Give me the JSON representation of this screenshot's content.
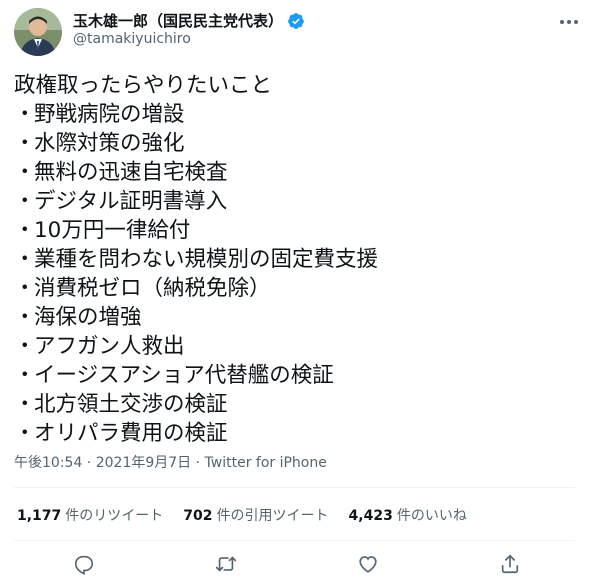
{
  "author": {
    "name": "玉木雄一郎（国民民主党代表）",
    "handle": "@tamakiyuichiro"
  },
  "icons": {
    "avatar": "avatar",
    "verified": "verified-badge-icon",
    "more": "more-options-icon",
    "reply": "reply-icon",
    "retweet": "retweet-icon",
    "like": "like-icon",
    "share": "share-icon"
  },
  "colors": {
    "text": "#0f1419",
    "secondary": "#536471",
    "verified": "#1d9bf0",
    "divider": "#eff3f4"
  },
  "tweet": {
    "heading": "政権取ったらやりたいこと",
    "bullet": "・",
    "items": [
      "野戦病院の増設",
      "水際対策の強化",
      "無料の迅速自宅検査",
      "デジタル証明書導入",
      "10万円一律給付",
      "業種を問わない規模別の固定費支援",
      "消費税ゼロ（納税免除）",
      "海保の増強",
      "アフガン人救出",
      "イージスアショア代替艦の検証",
      "北方領土交渉の検証",
      "オリパラ費用の検証"
    ]
  },
  "meta": {
    "time": "午後10:54",
    "sep1": " · ",
    "date": "2021年9月7日",
    "sep2": " · ",
    "source": "Twitter for iPhone"
  },
  "stats": {
    "retweets_count": "1,177",
    "retweets_label": "件のリツイート",
    "quotes_count": "702",
    "quotes_label": "件の引用ツイート",
    "likes_count": "4,423",
    "likes_label": "件のいいね"
  }
}
